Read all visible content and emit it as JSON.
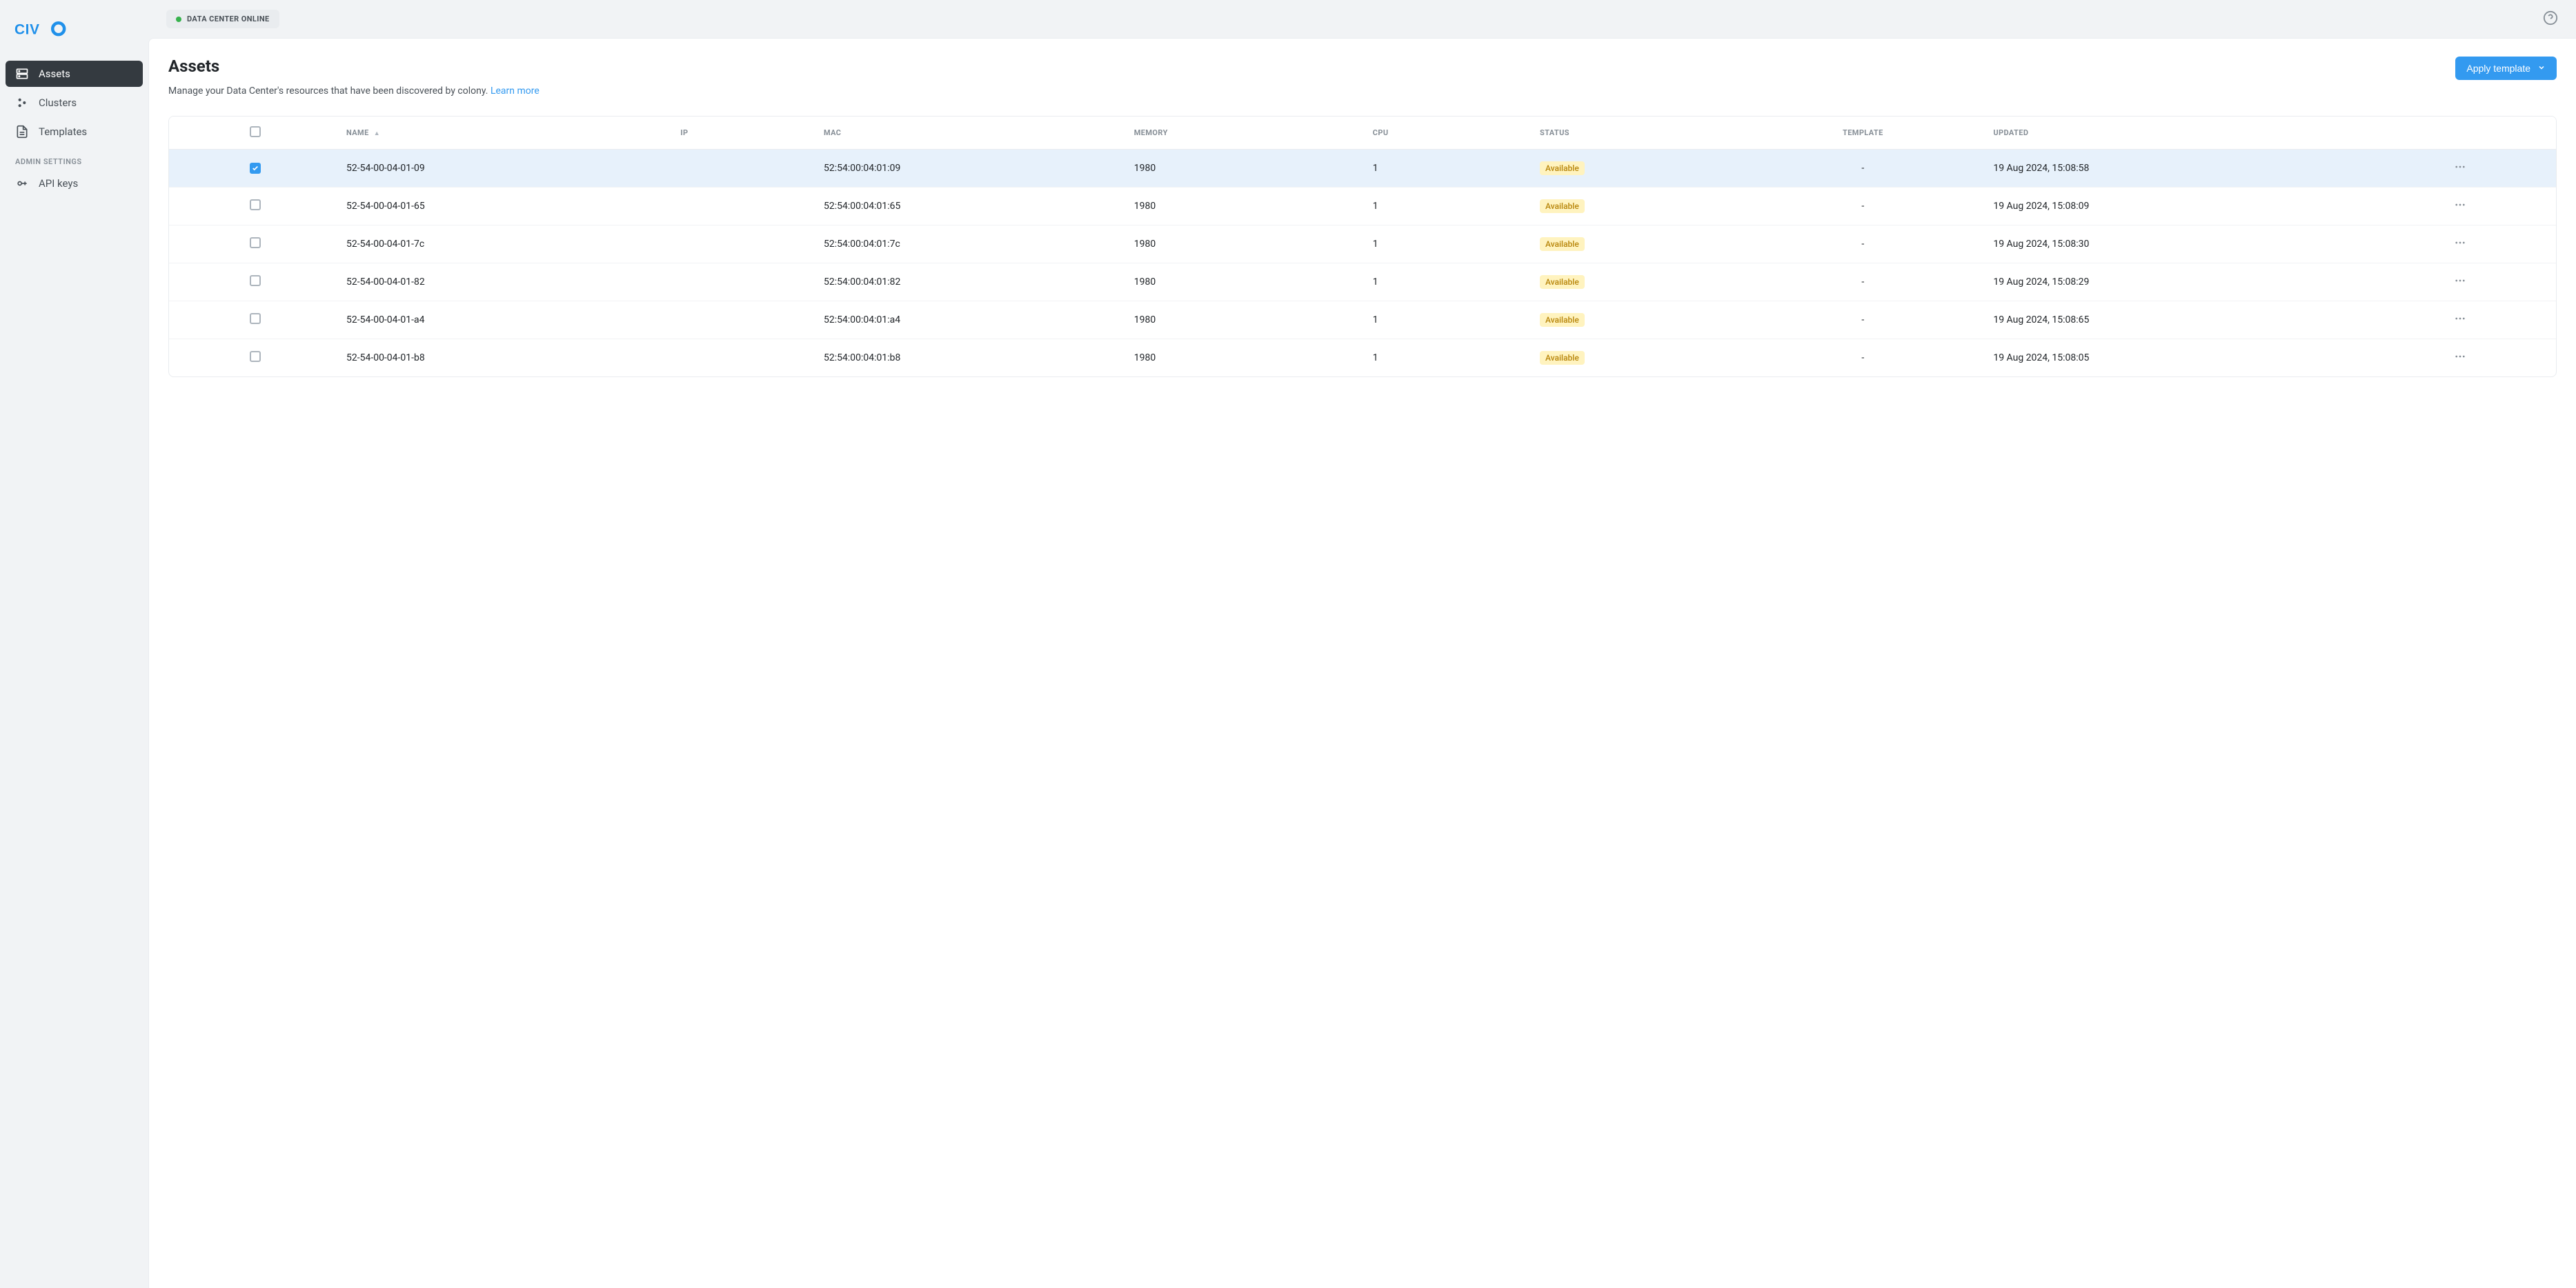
{
  "header": {
    "status_label": "DATA CENTER ONLINE"
  },
  "sidebar": {
    "items": [
      {
        "label": "Assets",
        "active": true
      },
      {
        "label": "Clusters",
        "active": false
      },
      {
        "label": "Templates",
        "active": false
      }
    ],
    "admin_label": "ADMIN SETTINGS",
    "admin_items": [
      {
        "label": "API keys"
      }
    ]
  },
  "page": {
    "title": "Assets",
    "description": "Manage your Data Center's resources that have been discovered by colony.",
    "learn_more": "Learn more",
    "apply_template_label": "Apply template"
  },
  "table": {
    "columns": {
      "name": "NAME",
      "ip": "IP",
      "mac": "MAC",
      "memory": "MEMORY",
      "cpu": "CPU",
      "status": "STATUS",
      "template": "TEMPLATE",
      "updated": "UPDATED"
    },
    "rows": [
      {
        "checked": true,
        "name": "52-54-00-04-01-09",
        "ip": "",
        "mac": "52:54:00:04:01:09",
        "memory": "1980",
        "cpu": "1",
        "status": "Available",
        "template": "-",
        "updated": "19 Aug 2024, 15:08:58"
      },
      {
        "checked": false,
        "name": "52-54-00-04-01-65",
        "ip": "",
        "mac": "52:54:00:04:01:65",
        "memory": "1980",
        "cpu": "1",
        "status": "Available",
        "template": "-",
        "updated": "19 Aug 2024, 15:08:09"
      },
      {
        "checked": false,
        "name": "52-54-00-04-01-7c",
        "ip": "",
        "mac": "52:54:00:04:01:7c",
        "memory": "1980",
        "cpu": "1",
        "status": "Available",
        "template": "-",
        "updated": "19 Aug 2024, 15:08:30"
      },
      {
        "checked": false,
        "name": "52-54-00-04-01-82",
        "ip": "",
        "mac": "52:54:00:04:01:82",
        "memory": "1980",
        "cpu": "1",
        "status": "Available",
        "template": "-",
        "updated": "19 Aug 2024, 15:08:29"
      },
      {
        "checked": false,
        "name": "52-54-00-04-01-a4",
        "ip": "",
        "mac": "52:54:00:04:01:a4",
        "memory": "1980",
        "cpu": "1",
        "status": "Available",
        "template": "-",
        "updated": "19 Aug 2024, 15:08:65"
      },
      {
        "checked": false,
        "name": "52-54-00-04-01-b8",
        "ip": "",
        "mac": "52:54:00:04:01:b8",
        "memory": "1980",
        "cpu": "1",
        "status": "Available",
        "template": "-",
        "updated": "19 Aug 2024, 15:08:05"
      }
    ]
  }
}
